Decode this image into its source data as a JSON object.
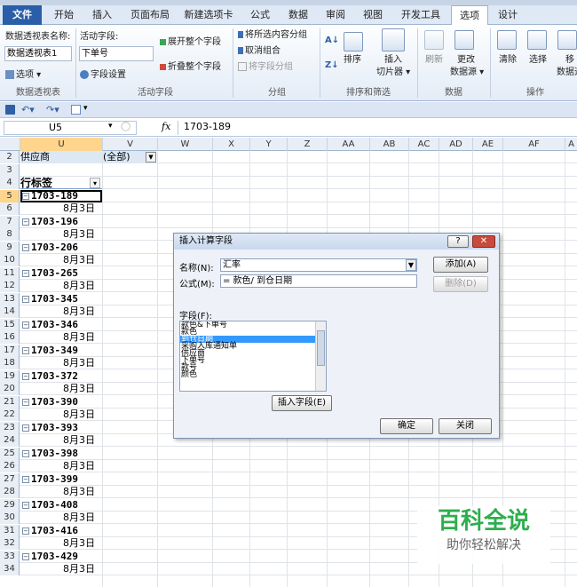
{
  "ribbon_tabs": [
    "文件",
    "开始",
    "插入",
    "页面布局",
    "新建选项卡",
    "公式",
    "数据",
    "审阅",
    "视图",
    "开发工具",
    "选项",
    "设计"
  ],
  "ribbon": {
    "pt_name_label": "数据透视表名称:",
    "pt_name_value": "数据透视表1",
    "options_label": "选项 ▾",
    "active_field_label": "活动字段:",
    "active_field_value": "下单号",
    "field_settings": "字段设置",
    "expand_all": "展开整个字段",
    "collapse_all": "折叠整个字段",
    "group_selection": "将所选内容分组",
    "ungroup": "取消组合",
    "group_field": "将字段分组",
    "sort": "排序",
    "insert_slicer": "插入",
    "insert_slicer2": "切片器 ▾",
    "refresh": "刷新",
    "change_source": "更改",
    "change_source2": "数据源 ▾",
    "clear": "清除",
    "select": "选择",
    "move": "移",
    "move2": "数据透",
    "groups": {
      "pivot": "数据透视表",
      "active_field": "活动字段",
      "group": "分组",
      "sort_filter": "排序和筛选",
      "data": "数据",
      "actions": "操作"
    }
  },
  "formula_bar": {
    "name_box": "U5",
    "fx": "fx",
    "value": "1703-189"
  },
  "columns": [
    "U",
    "V",
    "W",
    "X",
    "Y",
    "Z",
    "AA",
    "AB",
    "AC",
    "AD",
    "AE",
    "AF",
    "A"
  ],
  "sheet": {
    "filter_label": "供应商",
    "filter_value": "(全部)",
    "row_labels_header": "行标签",
    "rows": [
      {
        "n": "2"
      },
      {
        "n": "3"
      },
      {
        "n": "4"
      },
      {
        "n": "5",
        "u": "1703-189",
        "type": "group"
      },
      {
        "n": "6",
        "u": "8月3日",
        "type": "date"
      },
      {
        "n": "7",
        "u": "1703-196",
        "type": "group"
      },
      {
        "n": "8",
        "u": "8月3日",
        "type": "date"
      },
      {
        "n": "9",
        "u": "1703-206",
        "type": "group"
      },
      {
        "n": "10",
        "u": "8月3日",
        "type": "date"
      },
      {
        "n": "11",
        "u": "1703-265",
        "type": "group"
      },
      {
        "n": "12",
        "u": "8月3日",
        "type": "date"
      },
      {
        "n": "13",
        "u": "1703-345",
        "type": "group"
      },
      {
        "n": "14",
        "u": "8月3日",
        "type": "date"
      },
      {
        "n": "15",
        "u": "1703-346",
        "type": "group"
      },
      {
        "n": "16",
        "u": "8月3日",
        "type": "date"
      },
      {
        "n": "17",
        "u": "1703-349",
        "type": "group"
      },
      {
        "n": "18",
        "u": "8月3日",
        "type": "date"
      },
      {
        "n": "19",
        "u": "1703-372",
        "type": "group"
      },
      {
        "n": "20",
        "u": "8月3日",
        "type": "date"
      },
      {
        "n": "21",
        "u": "1703-390",
        "type": "group"
      },
      {
        "n": "22",
        "u": "8月3日",
        "type": "date"
      },
      {
        "n": "23",
        "u": "1703-393",
        "type": "group"
      },
      {
        "n": "24",
        "u": "8月3日",
        "type": "date"
      },
      {
        "n": "25",
        "u": "1703-398",
        "type": "group"
      },
      {
        "n": "26",
        "u": "8月3日",
        "type": "date"
      },
      {
        "n": "27",
        "u": "1703-399",
        "type": "group"
      },
      {
        "n": "28",
        "u": "8月3日",
        "type": "date"
      },
      {
        "n": "29",
        "u": "1703-408",
        "type": "group"
      },
      {
        "n": "30",
        "u": "8月3日",
        "type": "date"
      },
      {
        "n": "31",
        "u": "1703-416",
        "type": "group"
      },
      {
        "n": "32",
        "u": "8月3日",
        "type": "date"
      },
      {
        "n": "33",
        "u": "1703-429",
        "type": "group"
      },
      {
        "n": "34",
        "u": "8月3日",
        "type": "date"
      }
    ]
  },
  "dialog": {
    "title": "插入计算字段",
    "help": "?",
    "close_x": "✕",
    "name_label": "名称(N):",
    "name_value": "汇率",
    "formula_label": "公式(M):",
    "formula_value": "= 款色/ 到仓日期",
    "add_button": "添加(A)",
    "delete_button": "删除(D)",
    "fields_label": "字段(F):",
    "fields": [
      "款色&下单号",
      "款色",
      "到仓日期",
      "采购入库通知单",
      "供应商",
      "下单号",
      "款号",
      "颜色"
    ],
    "selected_field": "到仓日期",
    "insert_field_button": "插入字段(E)",
    "ok_button": "确定",
    "close_button": "关闭"
  },
  "watermark": {
    "title": "百科全说",
    "subtitle": "助你轻松解决"
  },
  "colors": {
    "file_tab": "#2a5ea8",
    "selection": "#ffd58d",
    "list_selection": "#3399ff",
    "watermark_green": "#2eae4f"
  }
}
